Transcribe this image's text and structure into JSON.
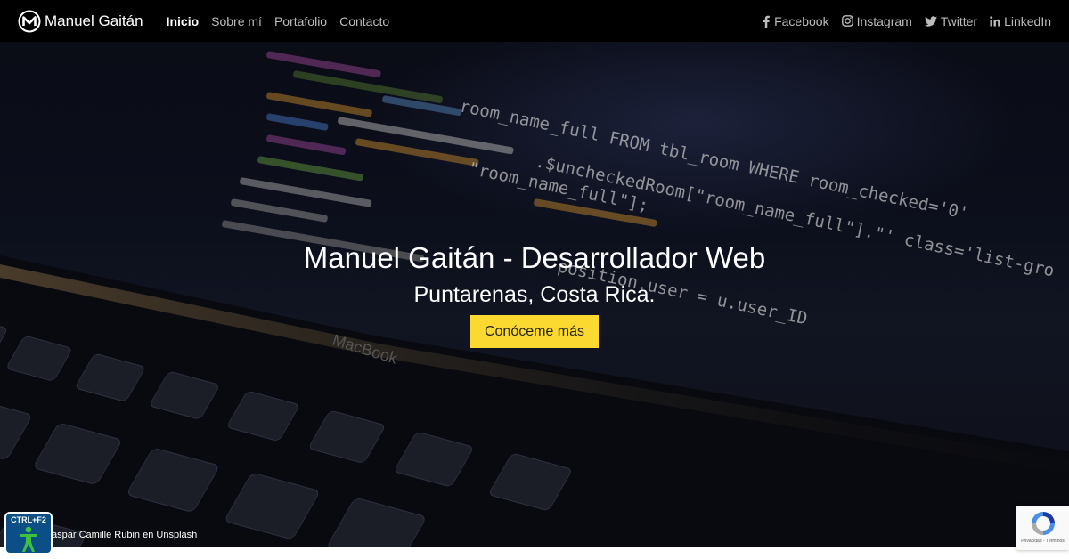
{
  "brand": {
    "name": "Manuel Gaitán",
    "logo_icon": "m-circle-logo"
  },
  "nav": {
    "items": [
      {
        "label": "Inicio",
        "active": true
      },
      {
        "label": "Sobre mí"
      },
      {
        "label": "Portafolio"
      },
      {
        "label": "Contacto"
      }
    ]
  },
  "social": [
    {
      "label": "Facebook",
      "icon": "facebook-icon"
    },
    {
      "label": "Instagram",
      "icon": "instagram-icon"
    },
    {
      "label": "Twitter",
      "icon": "twitter-icon"
    },
    {
      "label": "LinkedIn",
      "icon": "linkedin-icon"
    }
  ],
  "hero": {
    "title": "Manuel Gaitán - Desarrollador Web",
    "subtitle": "Puntarenas, Costa Rica.",
    "cta": "Conóceme más",
    "credit": "aspar Camille Rubin en Unsplash",
    "code_lines": [
      "room_name_full FROM tbl_room WHERE room_checked='0'",
      ".$uncheckedRoom[\"room_name_full\"].\"' class='list-gro",
      "\"room_name_full\"];",
      "position.user = u.user_ID"
    ],
    "laptop_text": "MacBook"
  },
  "accessibility": {
    "label": "CTRL+F2",
    "icon": "accessibility-person-icon"
  },
  "recaptcha": {
    "links": "Privacidad - Términos",
    "icon": "recaptcha-icon"
  },
  "colors": {
    "navbar": "#000000",
    "cta": "#fbd930",
    "accessibility": "#0b4f86"
  }
}
